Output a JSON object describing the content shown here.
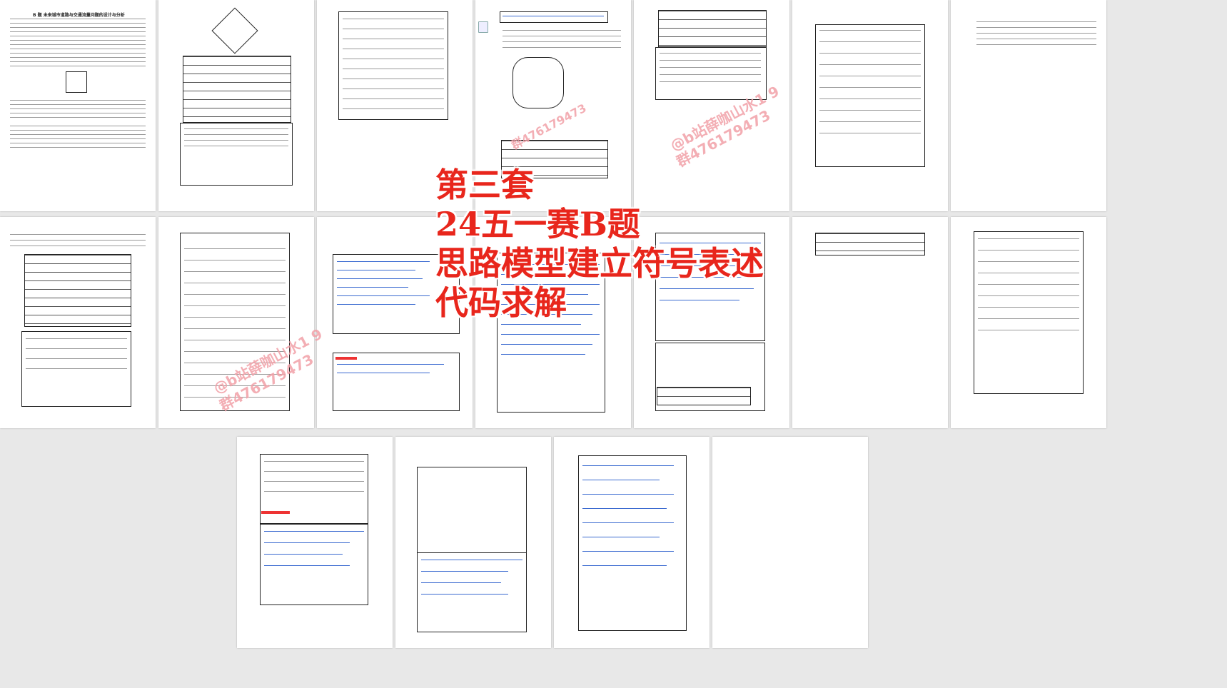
{
  "overlay": {
    "line1": "第三套",
    "line2": "24五一赛B题",
    "line3": "思路模型建立符号表述",
    "line4": "代码求解"
  },
  "watermark": {
    "a": "@b站薛咖山水1 9",
    "b": "群476179473"
  },
  "page1": {
    "title": "B 题   未来城市道路与交通流量问题的设计与分析"
  }
}
